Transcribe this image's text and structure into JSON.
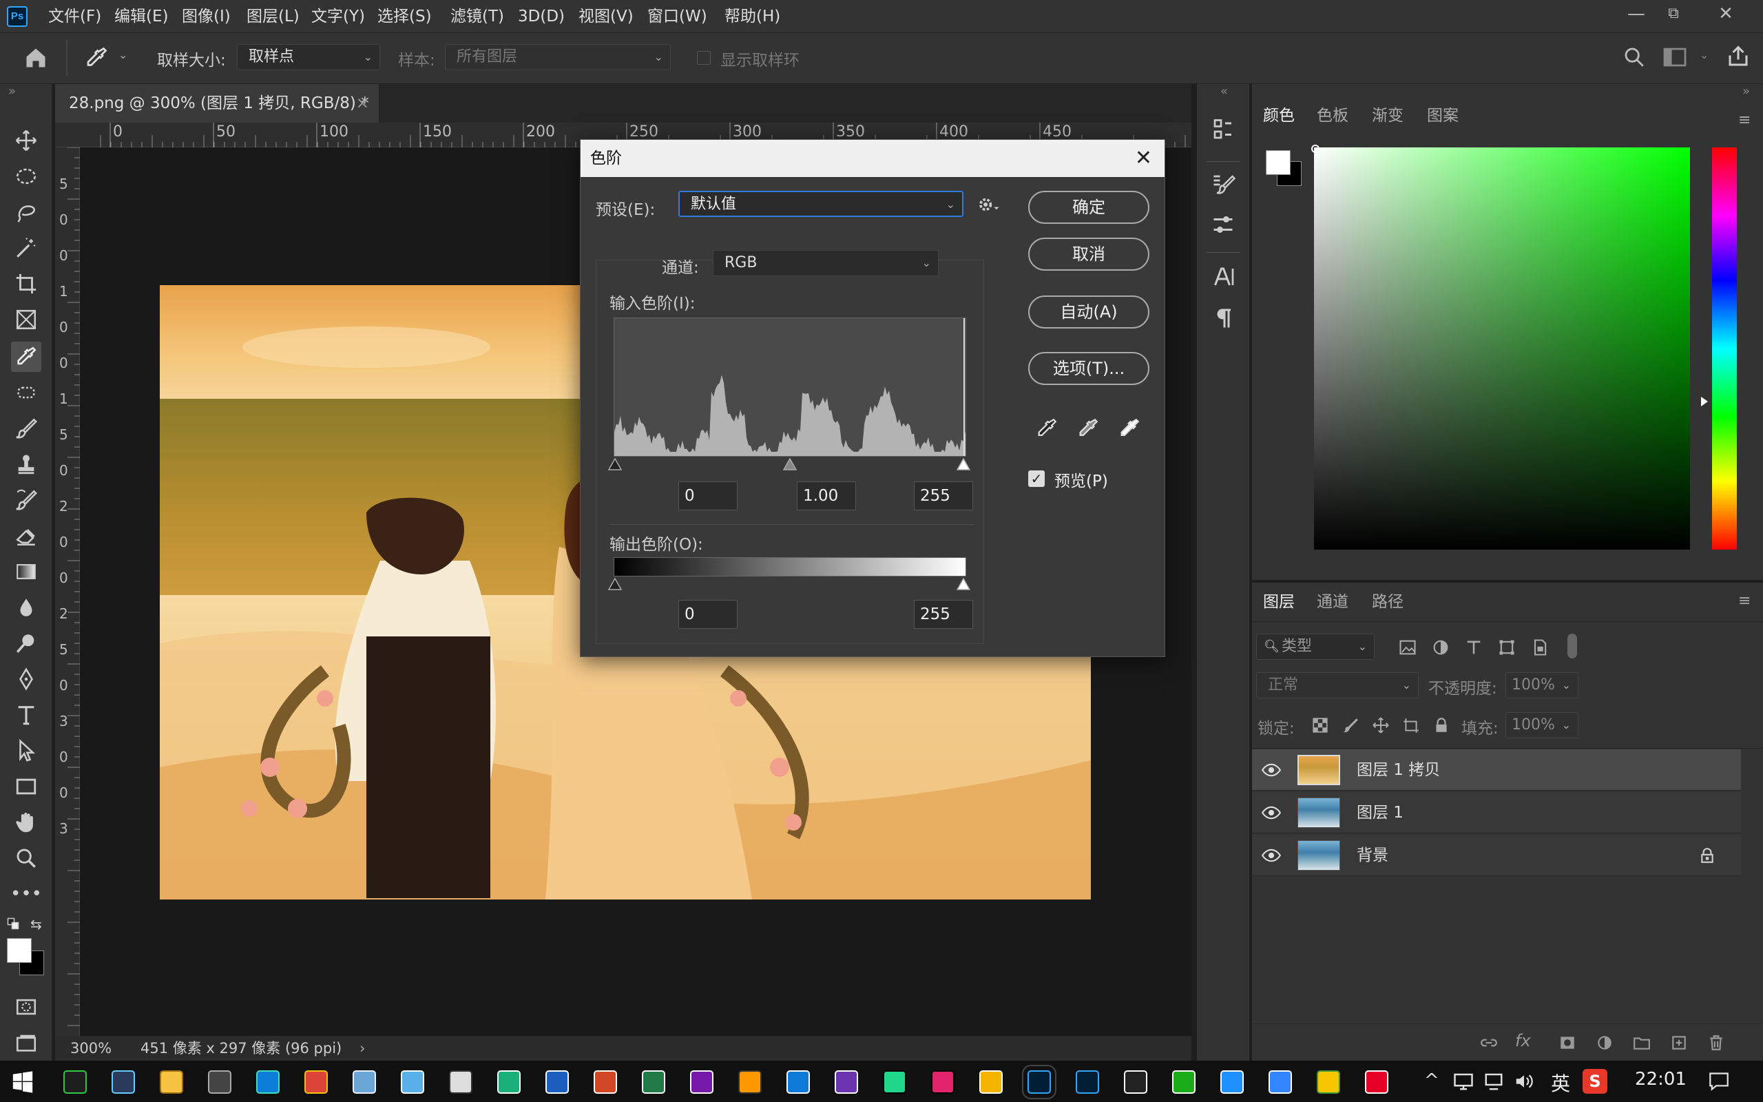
{
  "app": {
    "logo": "Ps"
  },
  "menu": [
    "文件(F)",
    "编辑(E)",
    "图像(I)",
    "图层(L)",
    "文字(Y)",
    "选择(S)",
    "滤镜(T)",
    "3D(D)",
    "视图(V)",
    "窗口(W)",
    "帮助(H)"
  ],
  "window_controls": {
    "minimize": "—",
    "restore": "⧉",
    "close": "✕"
  },
  "options_bar": {
    "sample_size_label": "取样大小:",
    "sample_size_value": "取样点",
    "sample_label": "样本:",
    "sample_value": "所有图层",
    "show_ring_label": "显示取样环"
  },
  "document": {
    "tab_title": "28.png @ 300% (图层 1 拷贝, RGB/8) *",
    "ruler_h_ticks": [
      "0",
      "50",
      "100",
      "150",
      "200",
      "250",
      "300",
      "350",
      "400",
      "450"
    ],
    "ruler_v_ticks": [
      "5",
      "0",
      "0",
      "1",
      "0",
      "0",
      "1",
      "5",
      "0",
      "2",
      "0",
      "0",
      "2",
      "5",
      "0",
      "3",
      "0",
      "0",
      "3"
    ],
    "zoom": "300%",
    "info": "451 像素 x 297 像素 (96 ppi)"
  },
  "levels_dialog": {
    "title": "色阶",
    "preset_label": "预设(E):",
    "preset_value": "默认值",
    "channel_label": "通道:",
    "channel_value": "RGB",
    "input_label": "输入色阶(I):",
    "input_black": "0",
    "input_gamma": "1.00",
    "input_white": "255",
    "output_label": "输出色阶(O):",
    "output_black": "0",
    "output_white": "255",
    "buttons": {
      "ok": "确定",
      "cancel": "取消",
      "auto": "自动(A)",
      "options": "选项(T)..."
    },
    "preview_label": "预览(P)",
    "preview_checked": true
  },
  "color_panel": {
    "tabs": [
      "颜色",
      "色板",
      "渐变",
      "图案"
    ],
    "active_tab": "颜色",
    "hue_color": "#00ff00"
  },
  "layers_panel": {
    "tabs": [
      "图层",
      "通道",
      "路径"
    ],
    "active_tab": "图层",
    "filter_placeholder": "类型",
    "blend_mode": "正常",
    "opacity_label": "不透明度:",
    "opacity_value": "100%",
    "lock_label": "锁定:",
    "fill_label": "填充:",
    "fill_value": "100%",
    "layers": [
      {
        "name": "图层 1 拷贝",
        "selected": true,
        "locked": false
      },
      {
        "name": "图层 1",
        "selected": false,
        "locked": false
      },
      {
        "name": "背景",
        "selected": false,
        "locked": true
      }
    ]
  },
  "taskbar": {
    "clock": "22:01",
    "ime": "英"
  }
}
